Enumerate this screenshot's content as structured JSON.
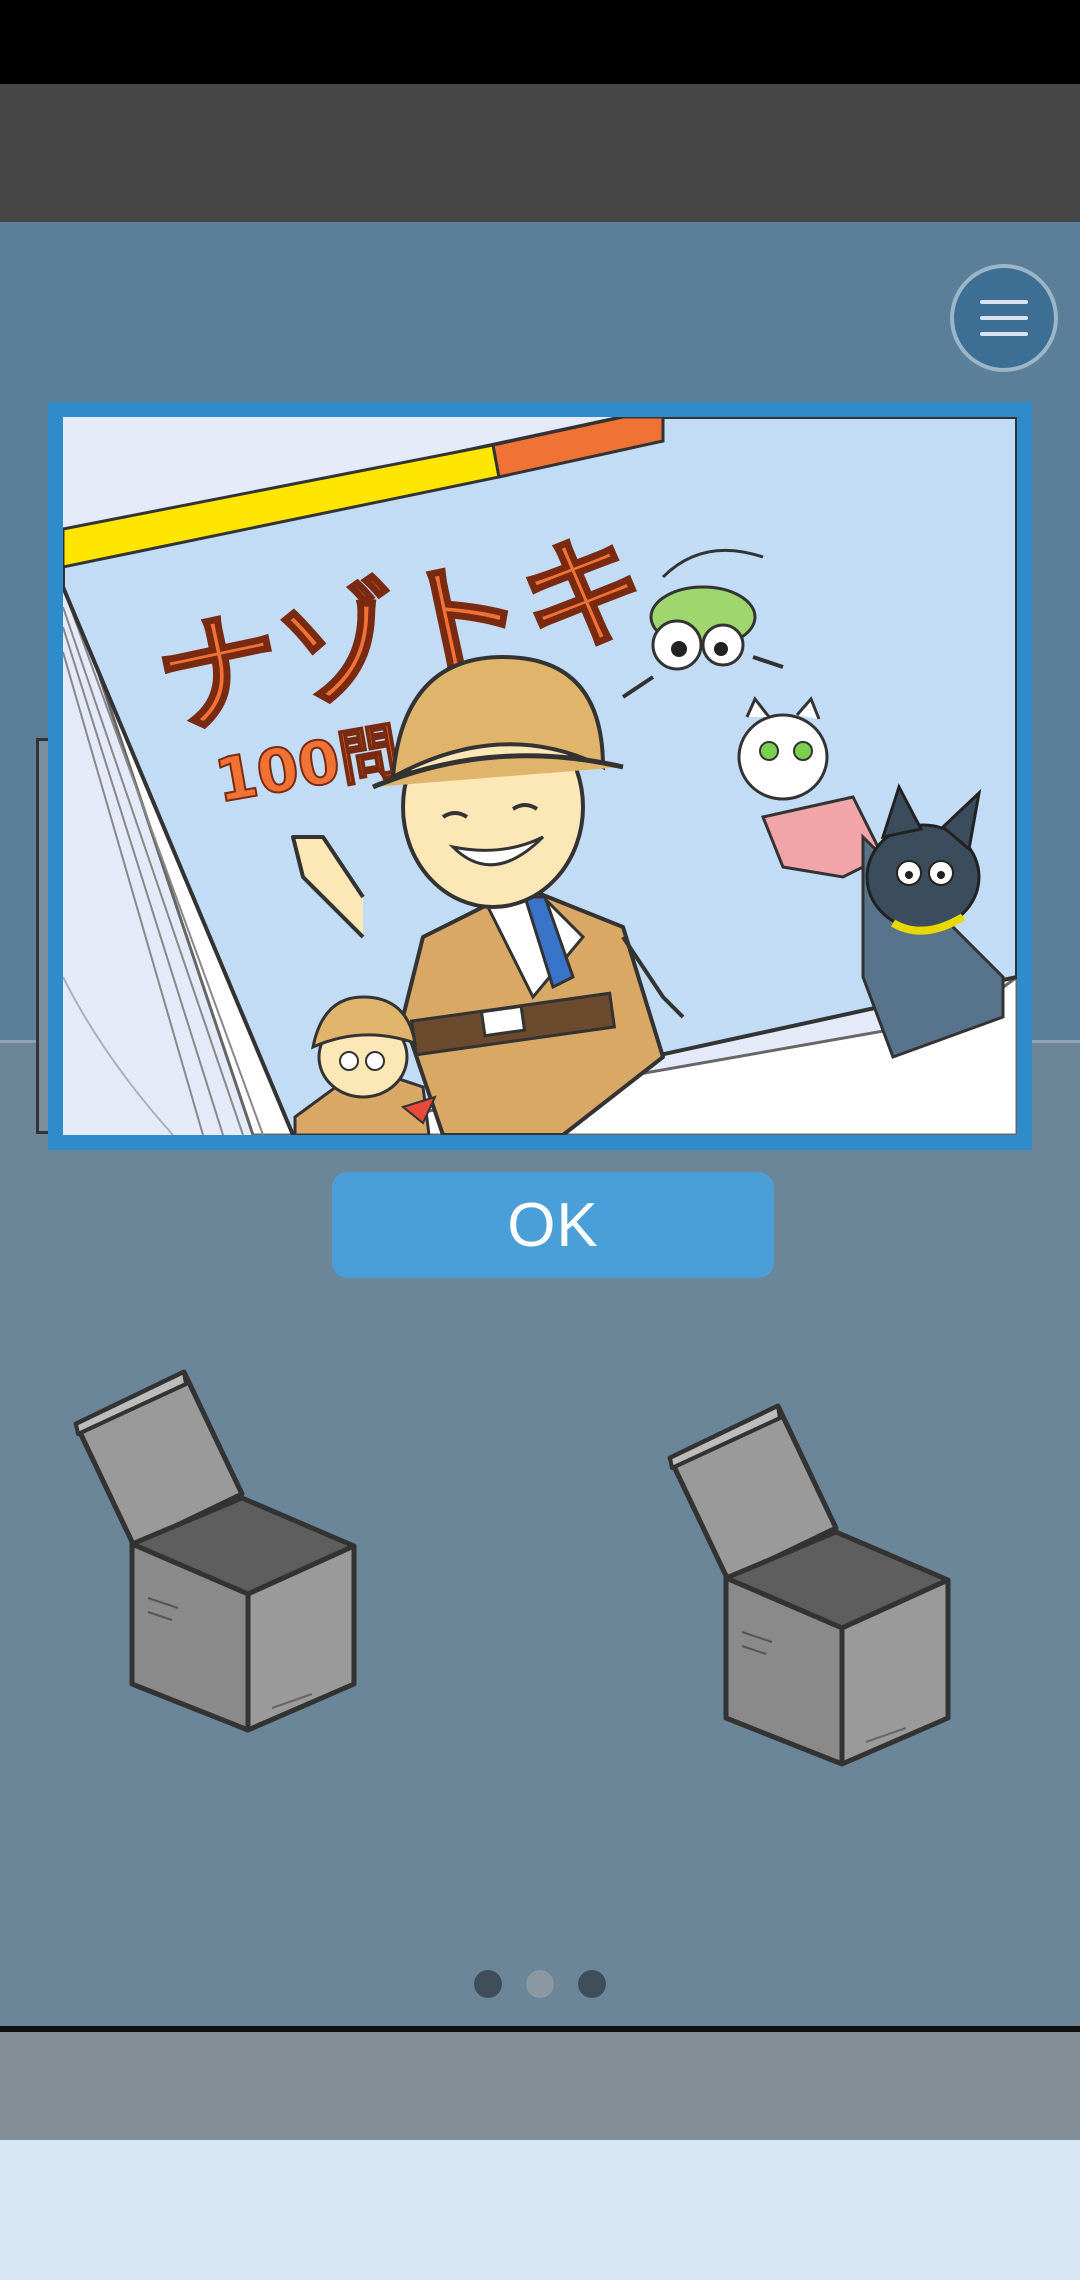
{
  "overlay": {
    "book_title": "ナゾトキ",
    "book_subtitle": "100問",
    "ok_label": "OK"
  },
  "menu": {
    "icon": "hamburger-menu-icon"
  },
  "boxes": [
    {
      "icon": "open-box-icon"
    },
    {
      "icon": "open-box-icon"
    }
  ],
  "pagination": {
    "total": 3,
    "active_index": 1
  },
  "colors": {
    "stage": "#5b7f98",
    "frame": "#2f8bc9",
    "ok_button": "#4a9fd8",
    "title_orange": "#f07235"
  }
}
